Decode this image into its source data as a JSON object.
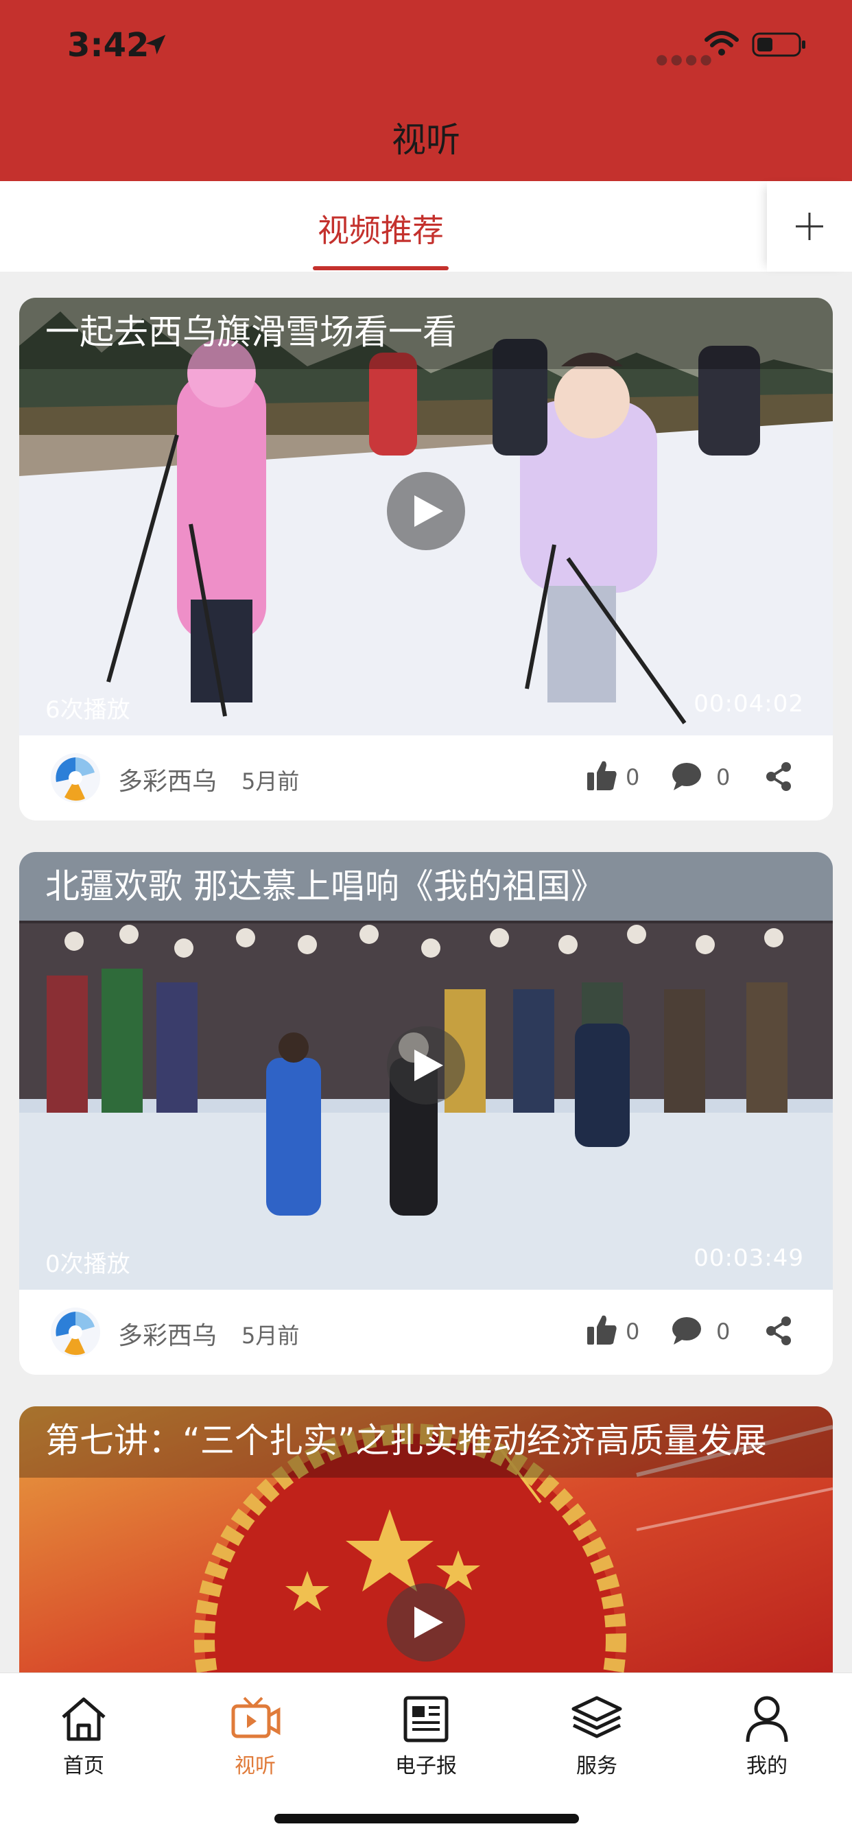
{
  "status_bar": {
    "time": "3:42"
  },
  "header": {
    "title": "视听"
  },
  "tabs": {
    "active_label": "视频推荐"
  },
  "colors": {
    "brand_red": "#c4312d",
    "nav_active": "#e07b3a"
  },
  "videos": [
    {
      "title": "一起去西乌旗滑雪场看一看",
      "play_count": "6次播放",
      "duration": "00:04:02",
      "source": "多彩西乌",
      "age": "5月前",
      "likes": "0",
      "comments": "0"
    },
    {
      "title": "北疆欢歌 那达慕上唱响《我的祖国》",
      "play_count": "0次播放",
      "duration": "00:03:49",
      "source": "多彩西乌",
      "age": "5月前",
      "likes": "0",
      "comments": "0"
    },
    {
      "title": "第七讲：“三个扎实”之扎实推动经济高质量发展"
    }
  ],
  "bottom_nav": [
    {
      "label": "首页",
      "icon": "home-icon"
    },
    {
      "label": "视听",
      "icon": "tv-icon",
      "active": true
    },
    {
      "label": "电子报",
      "icon": "newspaper-icon"
    },
    {
      "label": "服务",
      "icon": "layers-icon"
    },
    {
      "label": "我的",
      "icon": "user-icon"
    }
  ]
}
